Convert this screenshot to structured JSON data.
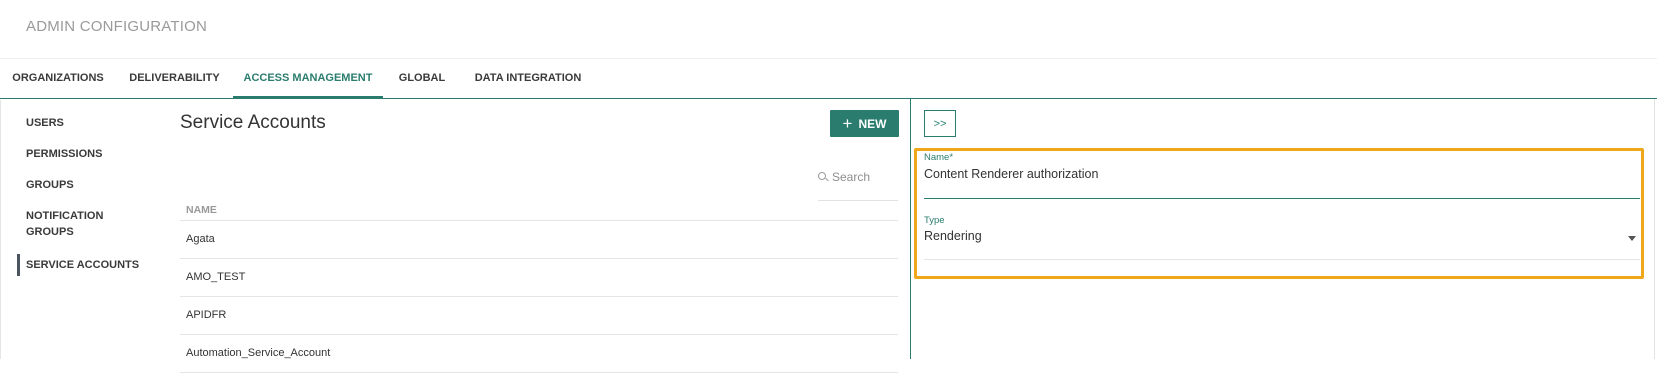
{
  "header": {
    "title": "ADMIN CONFIGURATION"
  },
  "tabs": [
    {
      "label": "ORGANIZATIONS"
    },
    {
      "label": "DELIVERABILITY"
    },
    {
      "label": "ACCESS MANAGEMENT",
      "active": true
    },
    {
      "label": "GLOBAL"
    },
    {
      "label": "DATA INTEGRATION"
    }
  ],
  "sidebar": {
    "items": [
      {
        "label": "USERS"
      },
      {
        "label": "PERMISSIONS"
      },
      {
        "label": "GROUPS"
      },
      {
        "label": "NOTIFICATION GROUPS"
      },
      {
        "label": "SERVICE ACCOUNTS",
        "active": true
      }
    ]
  },
  "main": {
    "title": "Service Accounts",
    "new_button": {
      "icon": "plus-icon",
      "label": "NEW"
    },
    "search": {
      "placeholder": "Search",
      "icon": "search-icon"
    },
    "table": {
      "column": "NAME",
      "rows": [
        "Agata",
        "AMO_TEST",
        "APIDFR",
        "Automation_Service_Account"
      ]
    }
  },
  "detail": {
    "collapse_label": ">>",
    "name_field": {
      "label": "Name*",
      "value": "Content Renderer authorization"
    },
    "type_field": {
      "label": "Type",
      "value": "Rendering",
      "icon": "caret-down-icon"
    }
  },
  "colors": {
    "accent": "#2a7d6e",
    "highlight": "#f0a81a"
  }
}
